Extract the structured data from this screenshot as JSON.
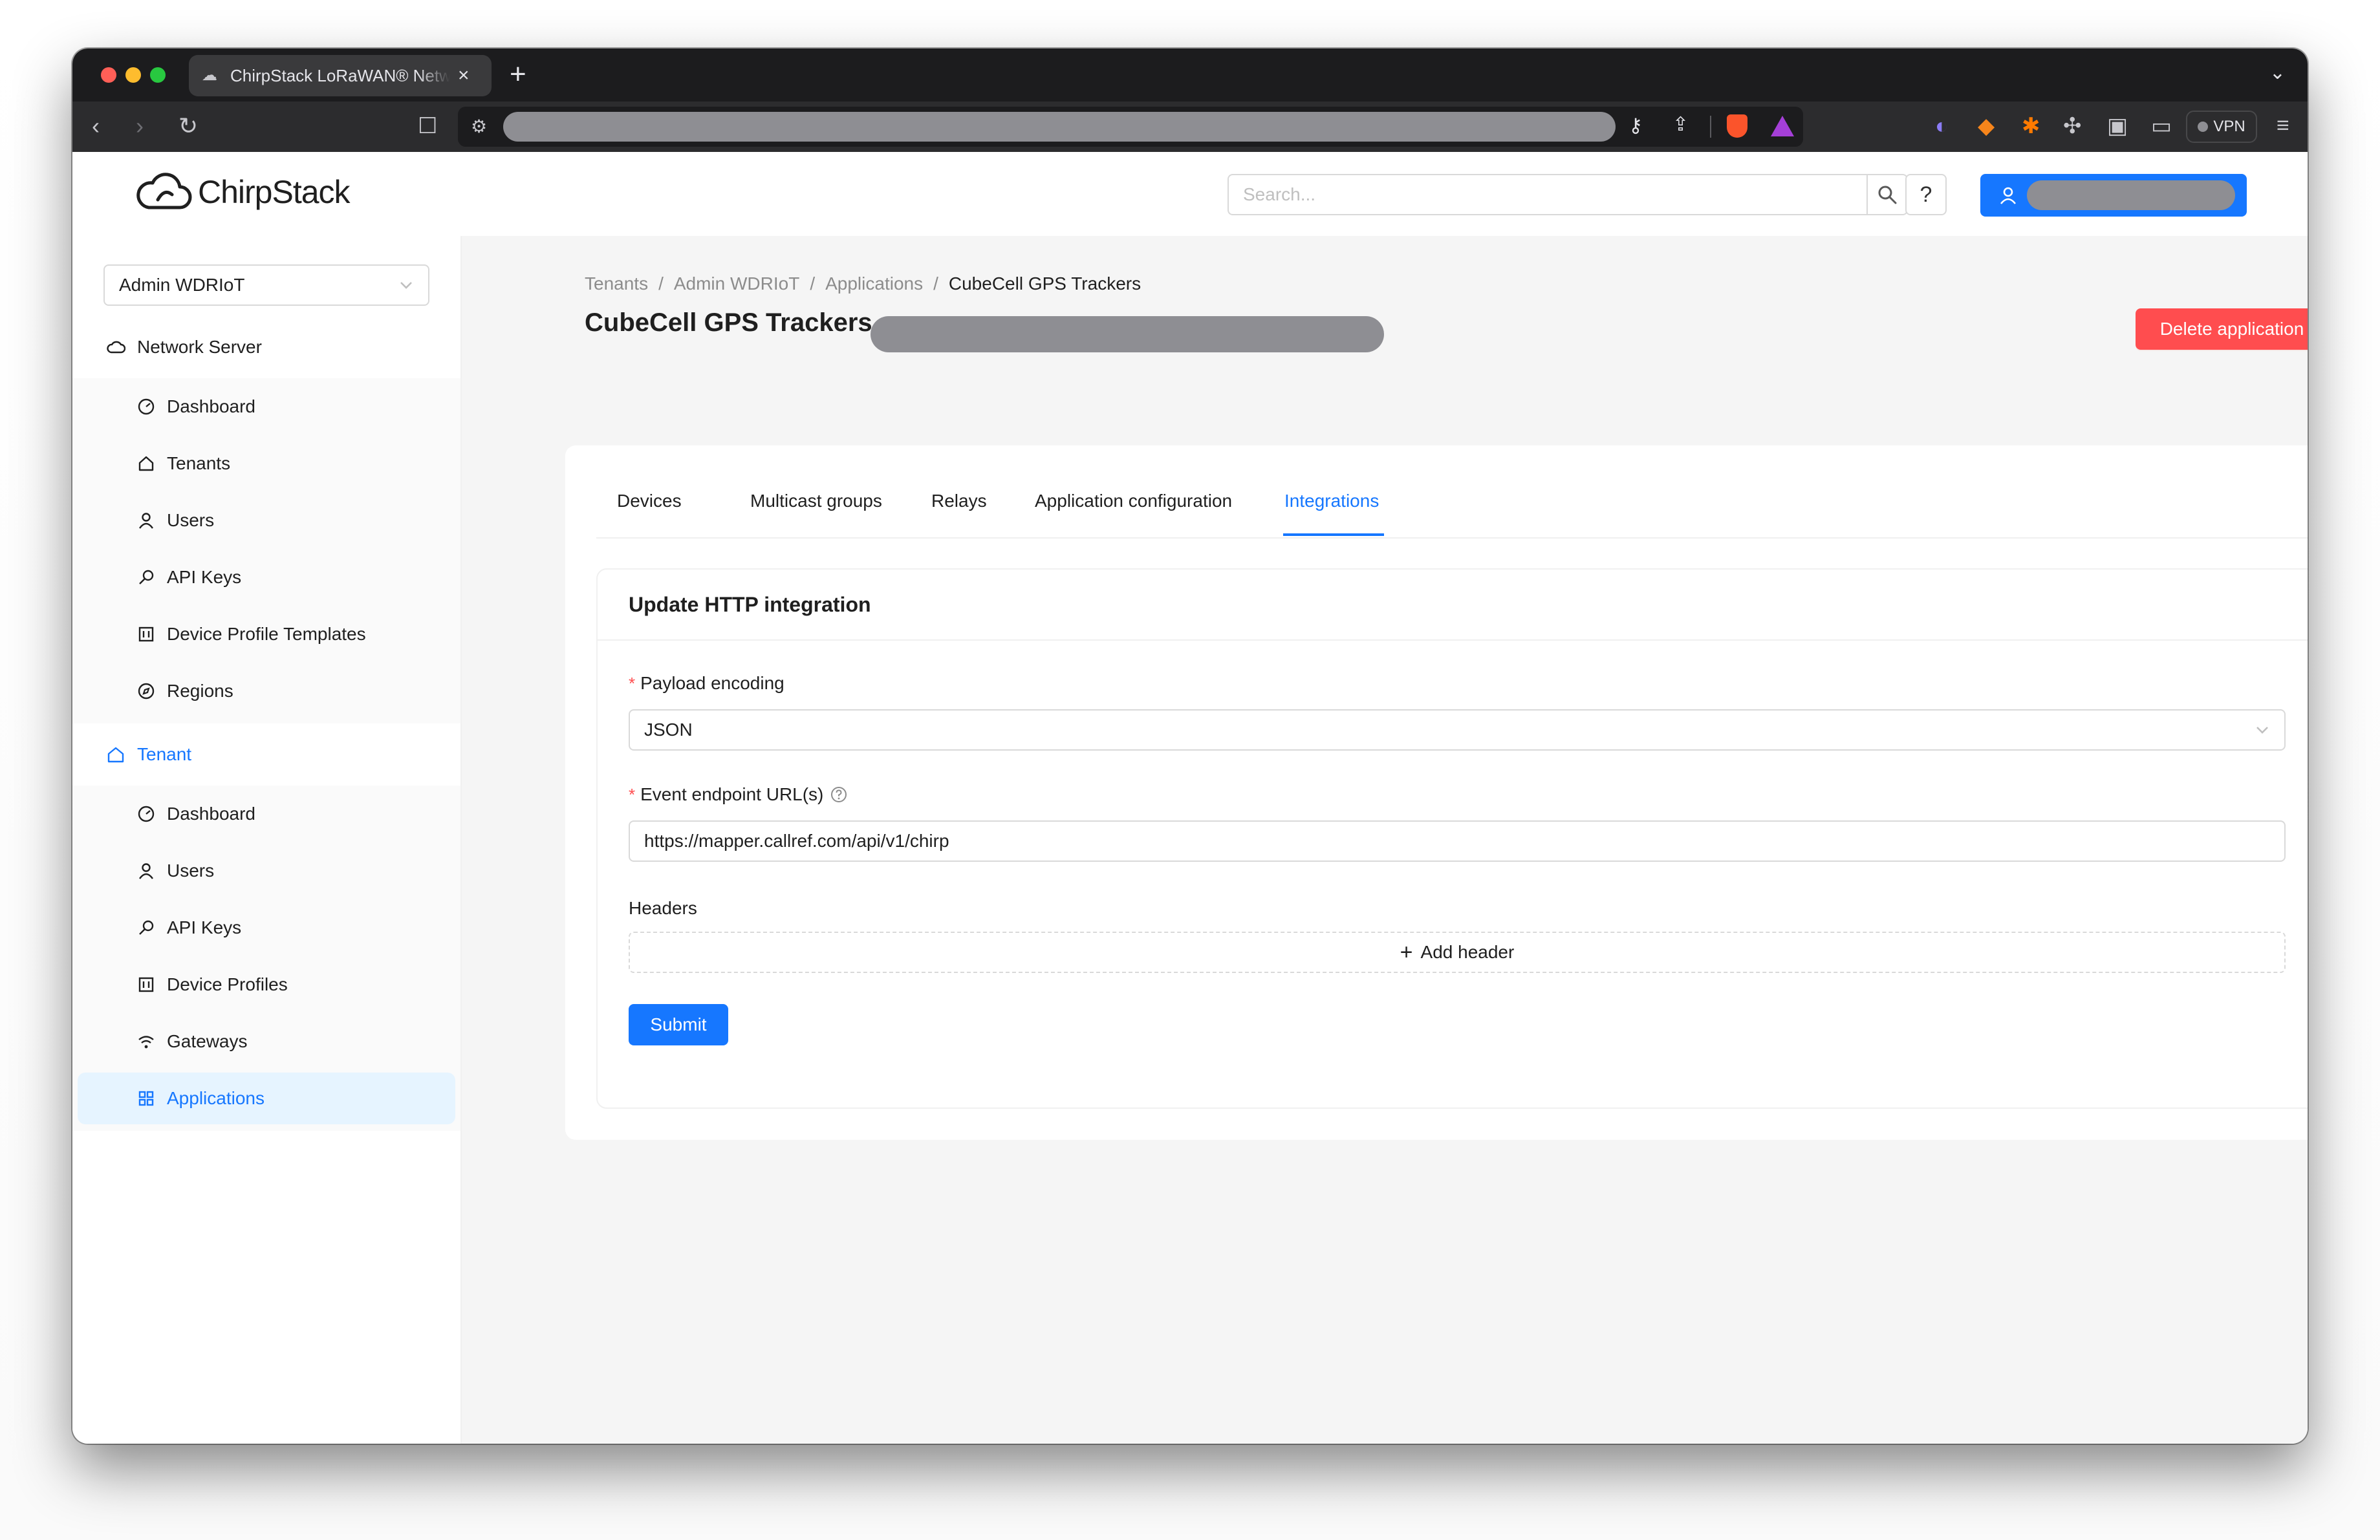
{
  "browser": {
    "tab_title": "ChirpStack LoRaWAN® Network Server",
    "vpn_label": "VPN"
  },
  "header": {
    "logo_text": "ChirpStack",
    "search_placeholder": "Search...",
    "help_label": "?"
  },
  "sidebar": {
    "tenant_selected": "Admin WDRIoT",
    "network_server": {
      "label": "Network Server",
      "items": [
        {
          "label": "Dashboard",
          "icon": "dashboard-icon"
        },
        {
          "label": "Tenants",
          "icon": "home-icon"
        },
        {
          "label": "Users",
          "icon": "user-icon"
        },
        {
          "label": "API Keys",
          "icon": "key-icon"
        },
        {
          "label": "Device Profile Templates",
          "icon": "profile-template-icon"
        },
        {
          "label": "Regions",
          "icon": "compass-icon"
        }
      ]
    },
    "tenant": {
      "label": "Tenant",
      "items": [
        {
          "label": "Dashboard",
          "icon": "dashboard-icon"
        },
        {
          "label": "Users",
          "icon": "user-icon"
        },
        {
          "label": "API Keys",
          "icon": "key-icon"
        },
        {
          "label": "Device Profiles",
          "icon": "profile-template-icon"
        },
        {
          "label": "Gateways",
          "icon": "wifi-icon"
        },
        {
          "label": "Applications",
          "icon": "apps-icon"
        }
      ]
    }
  },
  "page": {
    "breadcrumb": [
      "Tenants",
      "Admin WDRIoT",
      "Applications",
      "CubeCell GPS Trackers"
    ],
    "title": "CubeCell GPS Trackers",
    "delete_label": "Delete application",
    "tabs": [
      "Devices",
      "Multicast groups",
      "Relays",
      "Application configuration",
      "Integrations"
    ],
    "active_tab": "Integrations"
  },
  "form": {
    "title": "Update HTTP integration",
    "payload_encoding_label": "Payload encoding",
    "payload_encoding_value": "JSON",
    "endpoint_label": "Event endpoint URL(s)",
    "endpoint_value": "https://mapper.callref.com/api/v1/chirp",
    "headers_label": "Headers",
    "add_header_label": "Add header",
    "submit_label": "Submit"
  },
  "colors": {
    "primary": "#1677ff",
    "danger": "#ff4d4f"
  }
}
